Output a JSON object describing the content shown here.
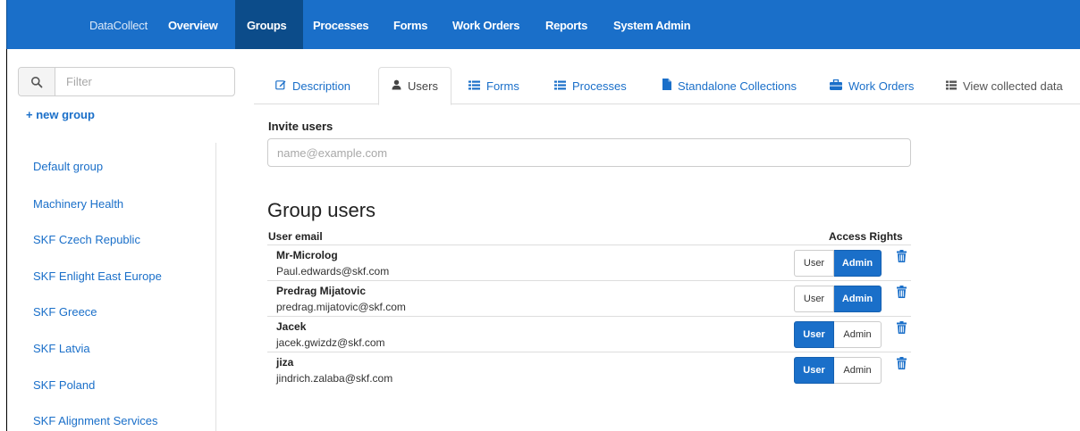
{
  "nav": {
    "brand": "DataCollect",
    "items": [
      "Overview",
      "Groups",
      "Processes",
      "Forms",
      "Work Orders",
      "Reports",
      "System Admin"
    ],
    "active": "Groups"
  },
  "sidebar": {
    "filter_placeholder": "Filter",
    "new_group": "+ new group",
    "groups": [
      "Default group",
      "Machinery Health",
      "SKF Czech Republic",
      "SKF Enlight East Europe",
      "SKF Greece",
      "SKF Latvia",
      "SKF Poland",
      "SKF Alignment Services"
    ]
  },
  "tabs": [
    {
      "label": "Description",
      "icon": "edit-icon"
    },
    {
      "label": "Users",
      "icon": "user-icon"
    },
    {
      "label": "Forms",
      "icon": "list-icon"
    },
    {
      "label": "Processes",
      "icon": "list-icon"
    },
    {
      "label": "Standalone Collections",
      "icon": "file-icon"
    },
    {
      "label": "Work Orders",
      "icon": "briefcase-icon"
    },
    {
      "label": "View collected data",
      "icon": "th-list-icon"
    }
  ],
  "active_tab": "Users",
  "invite": {
    "label": "Invite users",
    "placeholder": "name@example.com"
  },
  "group_users": {
    "title": "Group users",
    "col_email": "User email",
    "col_rights": "Access Rights",
    "role_user": "User",
    "role_admin": "Admin",
    "users": [
      {
        "name": "Mr-Microlog",
        "email": "Paul.edwards@skf.com",
        "role": "Admin"
      },
      {
        "name": "Predrag Mijatovic",
        "email": "predrag.mijatovic@skf.com",
        "role": "Admin"
      },
      {
        "name": "Jacek",
        "email": "jacek.gwizdz@skf.com",
        "role": "User"
      },
      {
        "name": "jiza",
        "email": "jindrich.zalaba@skf.com",
        "role": "User"
      }
    ]
  },
  "colors": {
    "primary": "#1a6fc9",
    "nav_active": "#0c4c8a",
    "text": "#333333"
  }
}
